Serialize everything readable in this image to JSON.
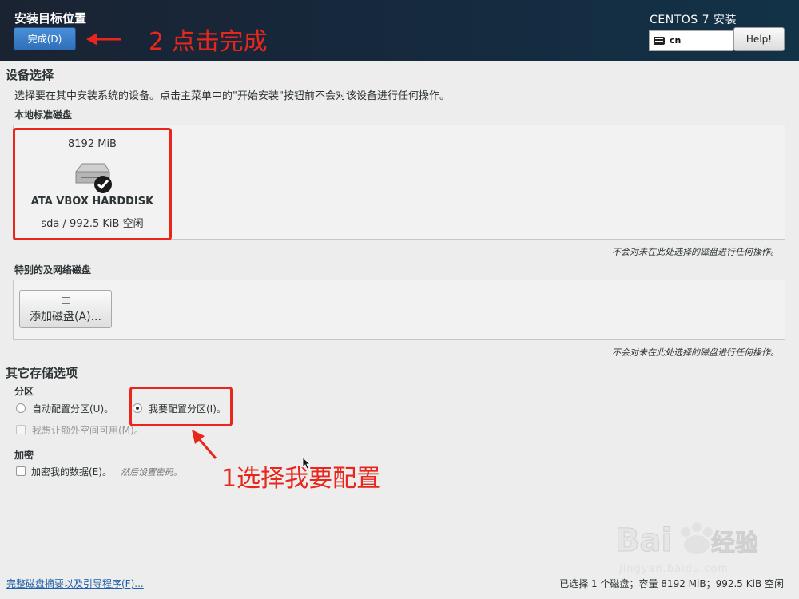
{
  "header": {
    "title": "安装目标位置",
    "done_label": "完成(D)",
    "product": "CENTOS 7 安装",
    "keyboard_layout": "cn",
    "help_label": "Help!"
  },
  "annotations": {
    "done": "2 点击完成",
    "select": "1选择我要配置"
  },
  "device_selection": {
    "title": "设备选择",
    "description": "选择要在其中安装系统的设备。点击主菜单中的\"开始安装\"按钮前不会对该设备进行任何操作。",
    "local_title": "本地标准磁盘",
    "disk": {
      "size": "8192 MiB",
      "name": "ATA VBOX HARDDISK",
      "free": "sda  /  992.5 KiB 空闲"
    },
    "local_note": "不会对未在此处选择的磁盘进行任何操作。",
    "special_title": "特别的及网络磁盘",
    "add_disk_label": "添加磁盘(A)...",
    "special_note": "不会对未在此处选择的磁盘进行任何操作。"
  },
  "other_storage": {
    "title": "其它存储选项",
    "partition_title": "分区",
    "auto_label": "自动配置分区(U)。",
    "manual_label": "我要配置分区(I)。",
    "extra_space_label": "我想让额外空间可用(M)。",
    "encryption_title": "加密",
    "encrypt_label": "加密我的数据(E)。",
    "encrypt_hint": "然后设置密码。"
  },
  "footer": {
    "summary_link": "完整磁盘摘要以及引导程序(F)...",
    "status": "已选择 1 个磁盘；容量 8192 MiB；992.5 KiB 空闲"
  },
  "watermark": {
    "brand": "Bai经验",
    "url": "jingyan.baidu.com"
  },
  "colors": {
    "header_bg": "#16283c",
    "accent": "#2f6fb8",
    "annotation_red": "#e8261c"
  }
}
